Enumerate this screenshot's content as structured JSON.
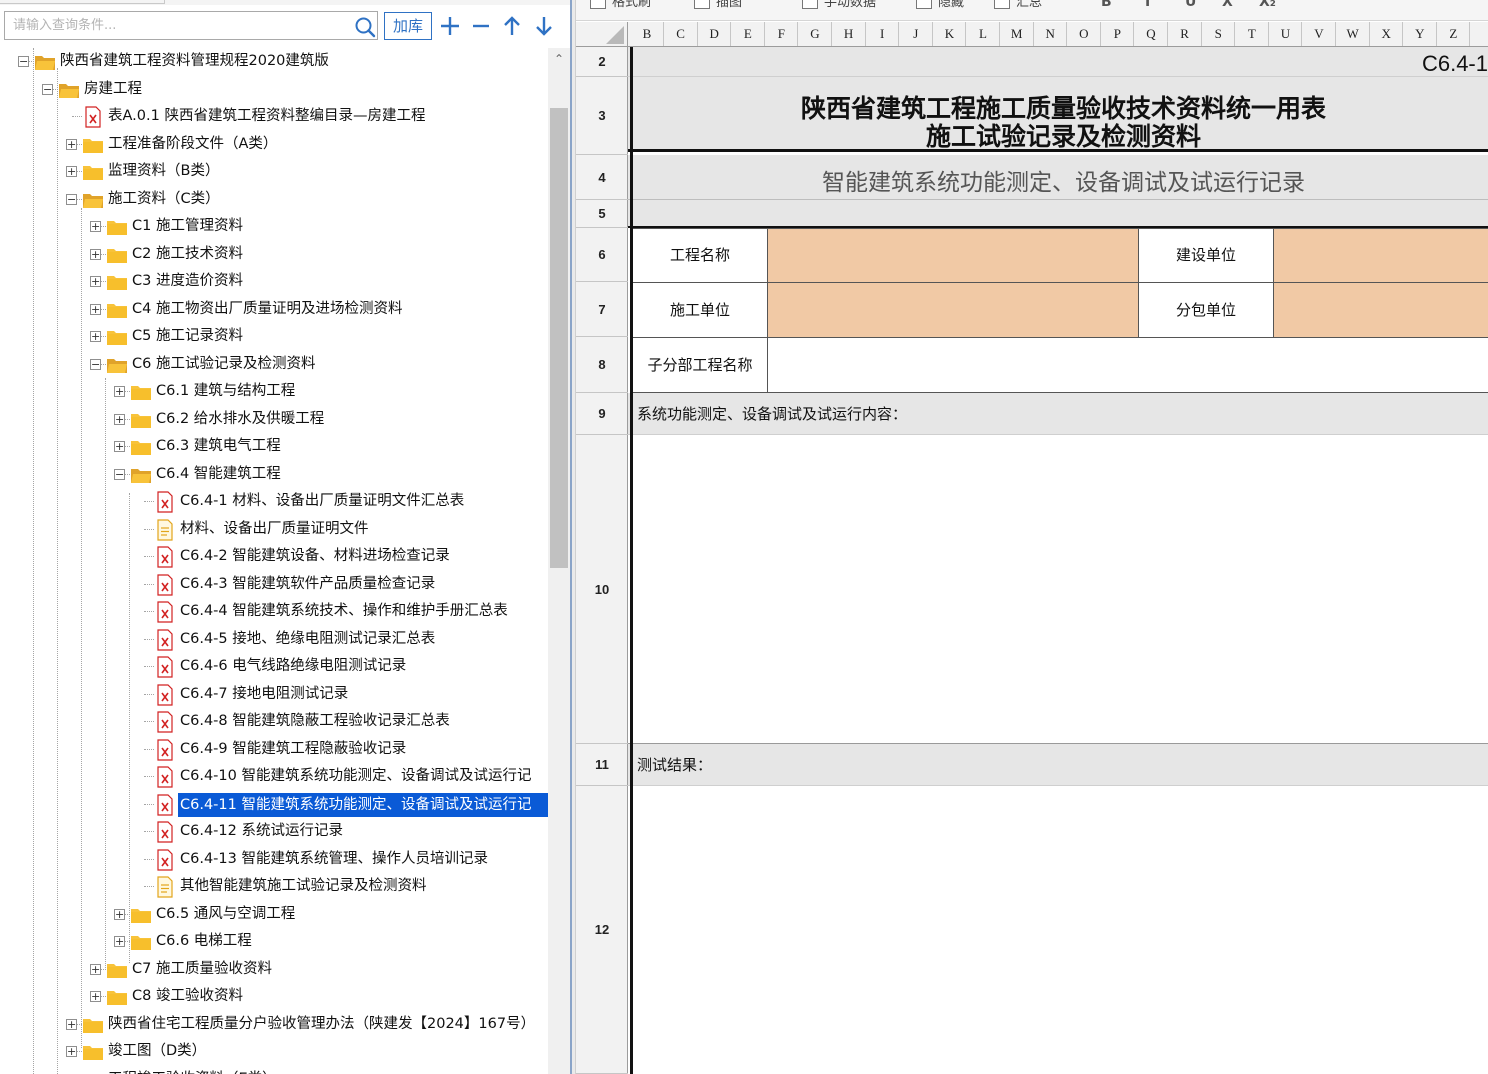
{
  "search": {
    "placeholder": "请输入查询条件...",
    "reload_label": "加库"
  },
  "toolbar_icons": [
    "plus-icon",
    "minus-icon",
    "arrow-up-icon",
    "arrow-down-icon"
  ],
  "tree": {
    "items": [
      {
        "label": "陕西省建筑工程资料管理规程2020建筑版",
        "type": "folder",
        "expanded": true
      },
      {
        "label": "房建工程",
        "type": "folder",
        "expanded": true
      },
      {
        "label": "表A.0.1 陕西省建筑工程资料整编目录—房建工程",
        "type": "table-doc"
      },
      {
        "label": "工程准备阶段文件（A类）",
        "type": "folder",
        "expanded": false
      },
      {
        "label": "监理资料（B类）",
        "type": "folder",
        "expanded": false
      },
      {
        "label": "施工资料（C类）",
        "type": "folder",
        "expanded": true
      },
      {
        "label": "C1 施工管理资料",
        "type": "folder",
        "expanded": false
      },
      {
        "label": "C2 施工技术资料",
        "type": "folder",
        "expanded": false
      },
      {
        "label": "C3 进度造价资料",
        "type": "folder",
        "expanded": false
      },
      {
        "label": "C4 施工物资出厂质量证明及进场检测资料",
        "type": "folder",
        "expanded": false
      },
      {
        "label": "C5 施工记录资料",
        "type": "folder",
        "expanded": false
      },
      {
        "label": "C6 施工试验记录及检测资料",
        "type": "folder",
        "expanded": true
      },
      {
        "label": "C6.1 建筑与结构工程",
        "type": "folder",
        "expanded": false
      },
      {
        "label": "C6.2 给水排水及供暖工程",
        "type": "folder",
        "expanded": false
      },
      {
        "label": "C6.3 建筑电气工程",
        "type": "folder",
        "expanded": false
      },
      {
        "label": "C6.4 智能建筑工程",
        "type": "folder",
        "expanded": true
      },
      {
        "label": "C6.4-1 材料、设备出厂质量证明文件汇总表",
        "type": "table-doc"
      },
      {
        "label": "材料、设备出厂质量证明文件",
        "type": "text-doc"
      },
      {
        "label": "C6.4-2 智能建筑设备、材料进场检查记录",
        "type": "table-doc"
      },
      {
        "label": "C6.4-3 智能建筑软件产品质量检查记录",
        "type": "table-doc"
      },
      {
        "label": "C6.4-4 智能建筑系统技术、操作和维护手册汇总表",
        "type": "table-doc"
      },
      {
        "label": "C6.4-5 接地、绝缘电阻测试记录汇总表",
        "type": "table-doc"
      },
      {
        "label": "C6.4-6 电气线路绝缘电阻测试记录",
        "type": "table-doc"
      },
      {
        "label": "C6.4-7 接地电阻测试记录",
        "type": "table-doc"
      },
      {
        "label": "C6.4-8 智能建筑隐蔽工程验收记录汇总表",
        "type": "table-doc"
      },
      {
        "label": "C6.4-9 智能建筑工程隐蔽验收记录",
        "type": "table-doc"
      },
      {
        "label": "C6.4-10 智能建筑系统功能测定、设备调试及试运行记",
        "type": "table-doc"
      },
      {
        "label": "C6.4-11 智能建筑系统功能测定、设备调试及试运行记",
        "type": "table-doc",
        "selected": true
      },
      {
        "label": "C6.4-12 系统试运行记录",
        "type": "table-doc"
      },
      {
        "label": "C6.4-13 智能建筑系统管理、操作人员培训记录",
        "type": "table-doc"
      },
      {
        "label": "其他智能建筑施工试验记录及检测资料",
        "type": "text-doc"
      },
      {
        "label": "C6.5 通风与空调工程",
        "type": "folder",
        "expanded": false
      },
      {
        "label": "C6.6 电梯工程",
        "type": "folder",
        "expanded": false
      },
      {
        "label": "C7 施工质量验收资料",
        "type": "folder",
        "expanded": false
      },
      {
        "label": "C8 竣工验收资料",
        "type": "folder",
        "expanded": false
      },
      {
        "label": "陕西省住宅工程质量分户验收管理办法（陕建发【2024】167号）",
        "type": "folder",
        "expanded": false
      },
      {
        "label": "竣工图（D类）",
        "type": "folder",
        "expanded": false
      },
      {
        "label": "工程竣工验收资料（E类）",
        "type": "folder",
        "expanded": false
      }
    ]
  },
  "ribbon": {
    "items": [
      "格式刷",
      "插图",
      "手动数据",
      "隐藏",
      "汇总"
    ],
    "format_glyphs": [
      "B",
      "I",
      "U",
      "X",
      "X₂"
    ]
  },
  "columns": [
    "B",
    "C",
    "D",
    "E",
    "F",
    "G",
    "H",
    "I",
    "J",
    "K",
    "L",
    "M",
    "N",
    "O",
    "P",
    "Q",
    "R",
    "S",
    "T",
    "U",
    "V",
    "W",
    "X",
    "Y",
    "Z"
  ],
  "rows": [
    "2",
    "3",
    "4",
    "5",
    "6",
    "7",
    "8",
    "9",
    "10",
    "11",
    "12"
  ],
  "sheet": {
    "form_code": "C6.4-1",
    "title_line1": "陕西省建筑工程施工质量验收技术资料统一用表",
    "title_line2": "施工试验记录及检测资料",
    "subtitle": "智能建筑系统功能测定、设备调试及试运行记录",
    "project_name_label": "工程名称",
    "construction_unit_label": "建设单位",
    "builder_label": "施工单位",
    "subcontractor_label": "分包单位",
    "sub_project_label": "子分部工程名称",
    "content_label": "系统功能测定、设备调试及试运行内容：",
    "result_label": "测试结果："
  },
  "colors": {
    "selection": "#0a5ad6",
    "input_fill": "#f1c9a5",
    "band_gray": "#e6e6e6",
    "accent_blue": "#2f72c4",
    "folder_yellow": "#f8c33a",
    "doc_red": "#d22222"
  }
}
